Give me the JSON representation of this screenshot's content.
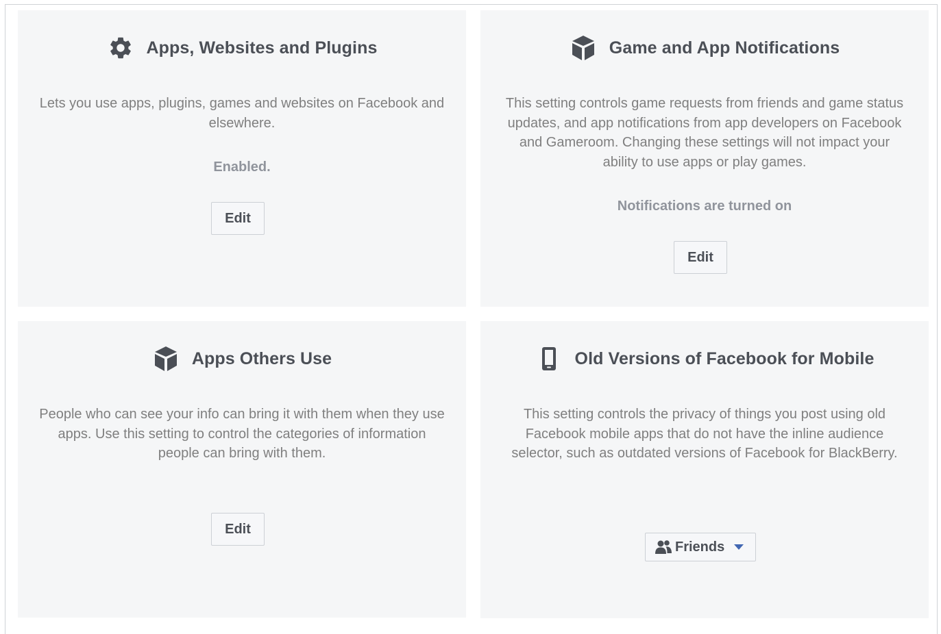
{
  "cards": [
    {
      "icon": "gear-icon",
      "title": "Apps, Websites and Plugins",
      "description": "Lets you use apps, plugins, games and websites on Facebook and elsewhere.",
      "status": "Enabled.",
      "button_label": "Edit"
    },
    {
      "icon": "cube-icon",
      "title": "Game and App Notifications",
      "description": "This setting controls game requests from friends and game status updates, and app notifications from app developers on Facebook and Gameroom. Changing these settings will not impact your ability to use apps or play games.",
      "status": "Notifications are turned on",
      "button_label": "Edit"
    },
    {
      "icon": "cube-icon",
      "title": "Apps Others Use",
      "description": "People who can see your info can bring it with them when they use apps. Use this setting to control the categories of information people can bring with them.",
      "button_label": "Edit"
    },
    {
      "icon": "mobile-phone-icon",
      "title": "Old Versions of Facebook for Mobile",
      "description": "This setting controls the privacy of things you post using old Facebook mobile apps that do not have the inline audience selector, such as outdated versions of Facebook for BlackBerry.",
      "audience_selector": {
        "icon": "friends-icon",
        "label": "Friends",
        "caret": "caret-down-icon"
      }
    }
  ],
  "colors": {
    "card_background": "#f5f6f7",
    "title_text": "#4b4f56",
    "description_text": "#7f7f7f",
    "status_text": "#90949c",
    "icon": "#4b4f56",
    "caret_blue": "#4267b2"
  }
}
